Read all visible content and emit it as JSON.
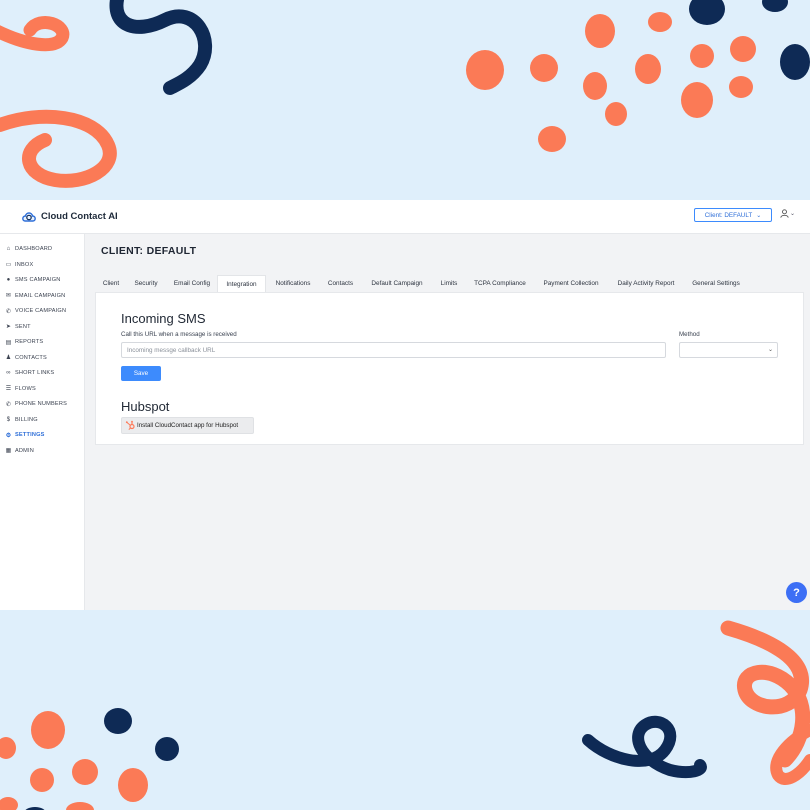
{
  "colors": {
    "accent": "#3d8bfd",
    "background": "#dfeffb",
    "deco_orange": "#fb7a56",
    "deco_navy": "#0e2a55"
  },
  "header": {
    "app_name": "Cloud Contact AI",
    "client_button": "Client: DEFAULT",
    "user_icon": "user-icon"
  },
  "sidebar": {
    "items": [
      {
        "label": "DASHBOARD",
        "icon": "home-icon",
        "glyph": "⌂"
      },
      {
        "label": "INBOX",
        "icon": "inbox-icon",
        "glyph": "▭"
      },
      {
        "label": "SMS CAMPAIGN",
        "icon": "chat-icon",
        "glyph": "●"
      },
      {
        "label": "EMAIL CAMPAIGN",
        "icon": "mail-icon",
        "glyph": "✉"
      },
      {
        "label": "VOICE CAMPAIGN",
        "icon": "phone-icon",
        "glyph": "✆"
      },
      {
        "label": "SENT",
        "icon": "send-icon",
        "glyph": "➤"
      },
      {
        "label": "REPORTS",
        "icon": "report-icon",
        "glyph": "▤"
      },
      {
        "label": "CONTACTS",
        "icon": "contacts-icon",
        "glyph": "♟"
      },
      {
        "label": "SHORT LINKS",
        "icon": "link-icon",
        "glyph": "∞"
      },
      {
        "label": "FLOWS",
        "icon": "flows-icon",
        "glyph": "☰"
      },
      {
        "label": "PHONE NUMBERS",
        "icon": "phone-number-icon",
        "glyph": "✆"
      },
      {
        "label": "BILLING",
        "icon": "dollar-icon",
        "glyph": "$"
      },
      {
        "label": "SETTINGS",
        "icon": "gear-icon",
        "glyph": "⚙",
        "active": true
      },
      {
        "label": "ADMIN",
        "icon": "admin-icon",
        "glyph": "▦"
      }
    ]
  },
  "main": {
    "page_title": "CLIENT: DEFAULT",
    "tabs": [
      {
        "label": "Client"
      },
      {
        "label": "Security"
      },
      {
        "label": "Email Config"
      },
      {
        "label": "Integration",
        "active": true
      },
      {
        "label": "Notifications"
      },
      {
        "label": "Contacts"
      },
      {
        "label": "Default Campaign"
      },
      {
        "label": "Limits"
      },
      {
        "label": "TCPA Compliance"
      },
      {
        "label": "Payment Collection"
      },
      {
        "label": "Daily Activity Report"
      },
      {
        "label": "General Settings"
      }
    ],
    "incoming_sms": {
      "heading": "Incoming SMS",
      "url_label": "Call this URL when a message is received",
      "url_placeholder": "Incoming messge callback URL",
      "url_value": "",
      "method_label": "Method",
      "method_value": "",
      "save_label": "Save"
    },
    "hubspot": {
      "heading": "Hubspot",
      "install_label": "Install CloudContact app for Hubspot"
    }
  },
  "help": {
    "label": "?"
  }
}
